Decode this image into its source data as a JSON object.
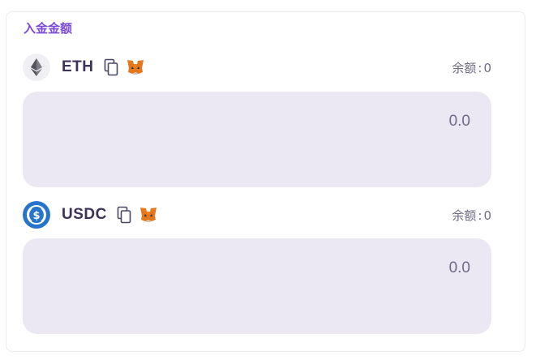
{
  "section": {
    "title": "入金金额"
  },
  "tokens": [
    {
      "symbol": "ETH",
      "icon": "ethereum-logo",
      "balance_label": "余额",
      "balance_sep": ":",
      "balance_value": "0",
      "amount_placeholder": "0.0"
    },
    {
      "symbol": "USDC",
      "icon": "usdc-logo",
      "balance_label": "余额",
      "balance_sep": ":",
      "balance_value": "0",
      "amount_placeholder": "0.0"
    }
  ],
  "icons": {
    "copy": "copy-icon",
    "wallet": "metamask-fox-icon"
  },
  "colors": {
    "accent": "#7b4bd9",
    "token_text": "#3d3257",
    "muted_text": "#6f6a86",
    "input_bg": "#ebe8f3",
    "usdc_blue": "#2775ca"
  }
}
